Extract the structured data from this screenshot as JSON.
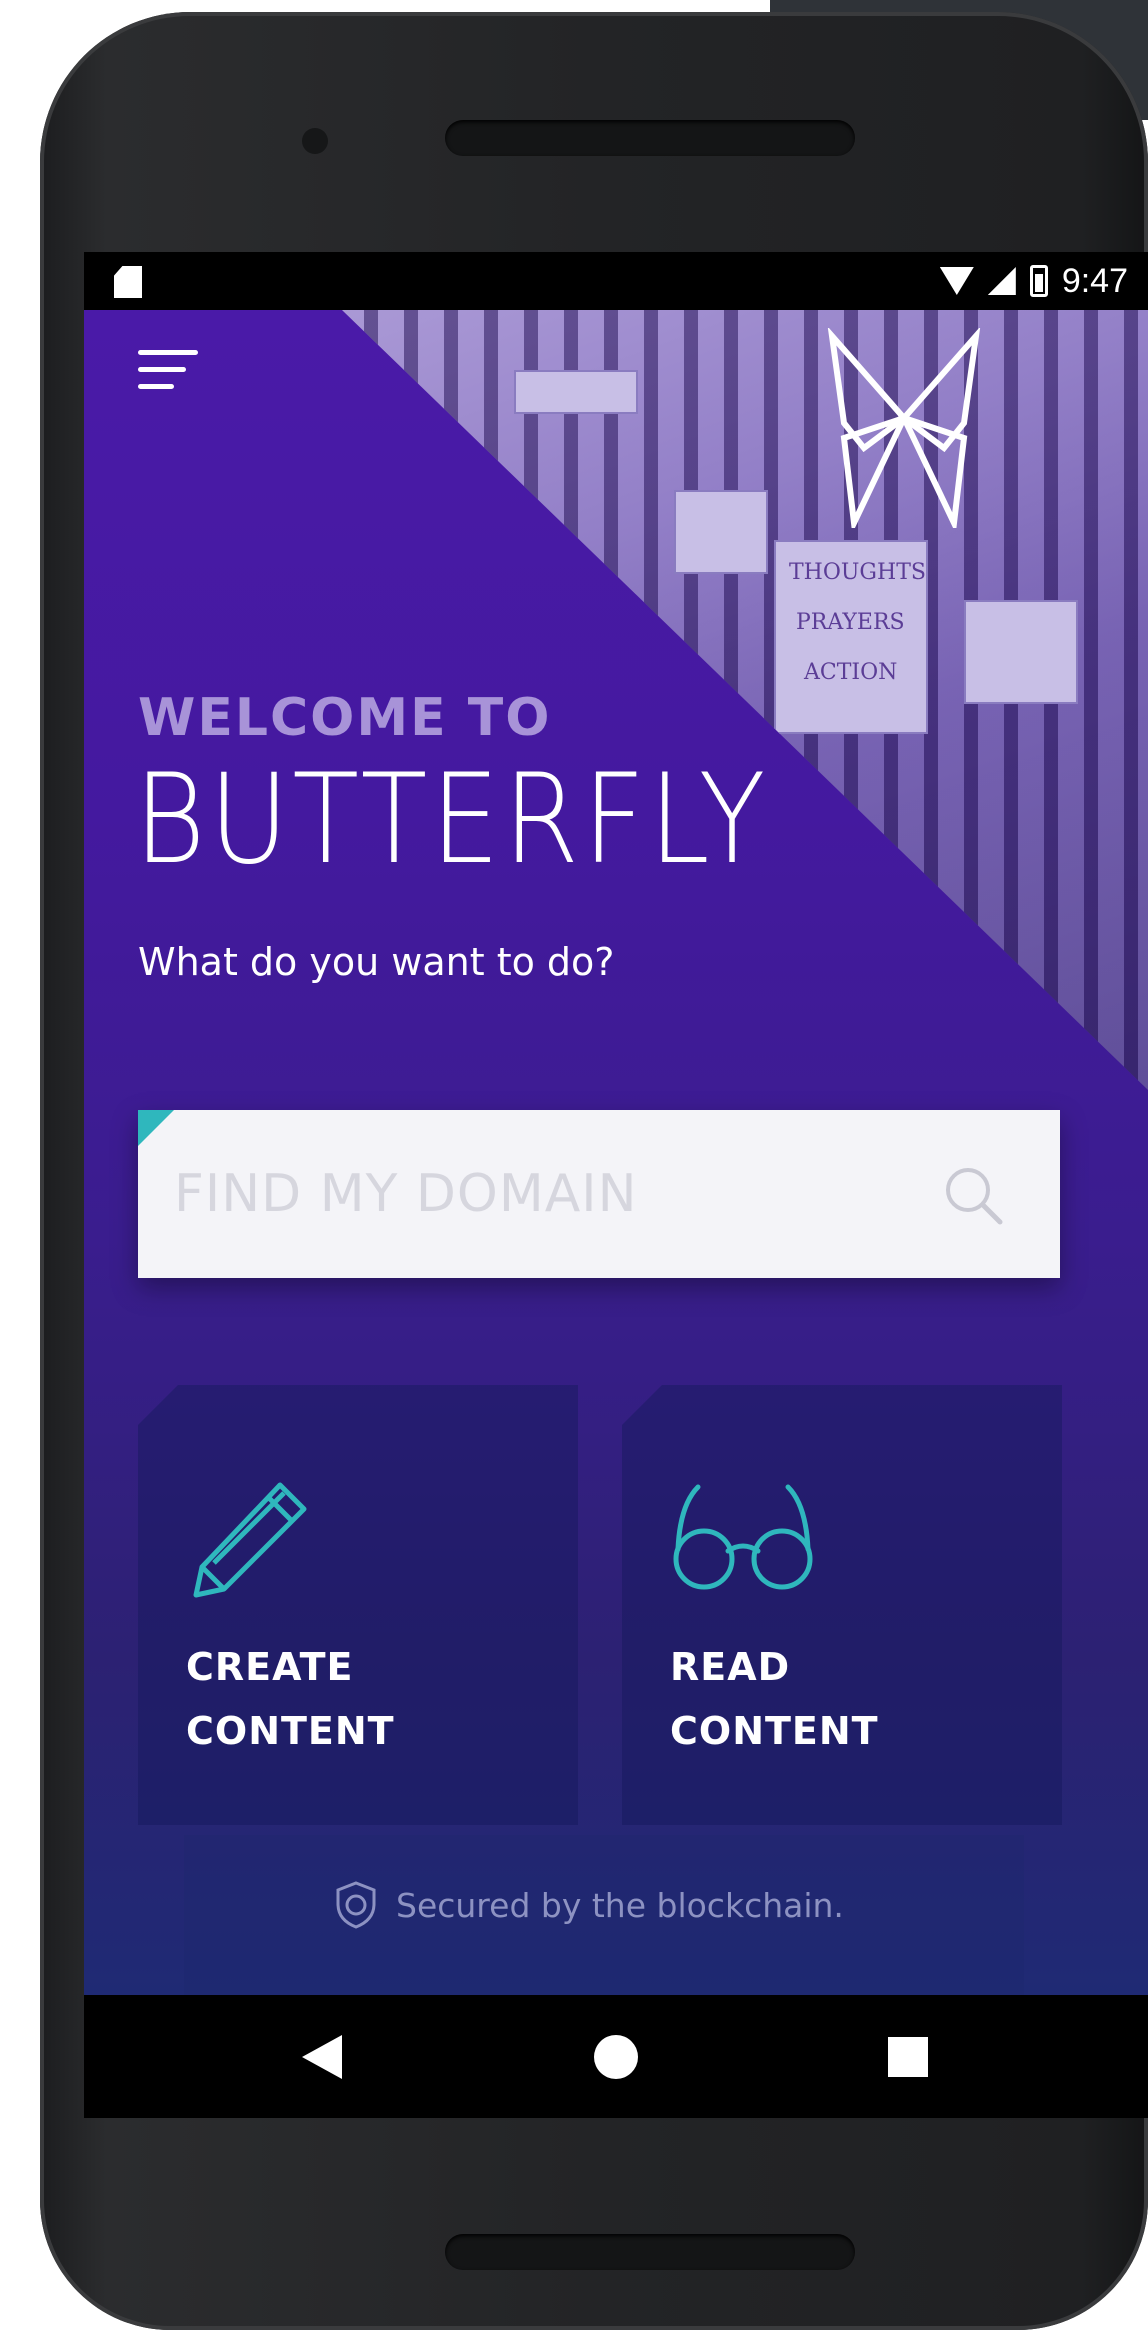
{
  "status_bar": {
    "time": "9:47"
  },
  "app": {
    "welcome_line": "WELCOME TO",
    "brand_name": "BUTTERFLY",
    "question": "What do you want to do?",
    "search": {
      "placeholder": "FIND MY DOMAIN",
      "value": ""
    },
    "cards": [
      {
        "line1": "CREATE",
        "line2": "CONTENT",
        "icon": "pencil-icon"
      },
      {
        "line1": "READ",
        "line2": "CONTENT",
        "icon": "glasses-icon"
      }
    ],
    "footer_text": "Secured by the blockchain.",
    "photo_signs": [
      "THOUGHTS",
      "PRAYERS",
      "ACTION"
    ]
  },
  "colors": {
    "accent": "#2fb7bd",
    "background_top": "#4a1aa8",
    "background_bottom": "#1f2a74",
    "welcome_text": "#a893d8",
    "footer_text": "#8d92c2"
  },
  "nav_bar": {
    "icons": [
      "back-icon",
      "home-icon",
      "recents-icon"
    ]
  }
}
